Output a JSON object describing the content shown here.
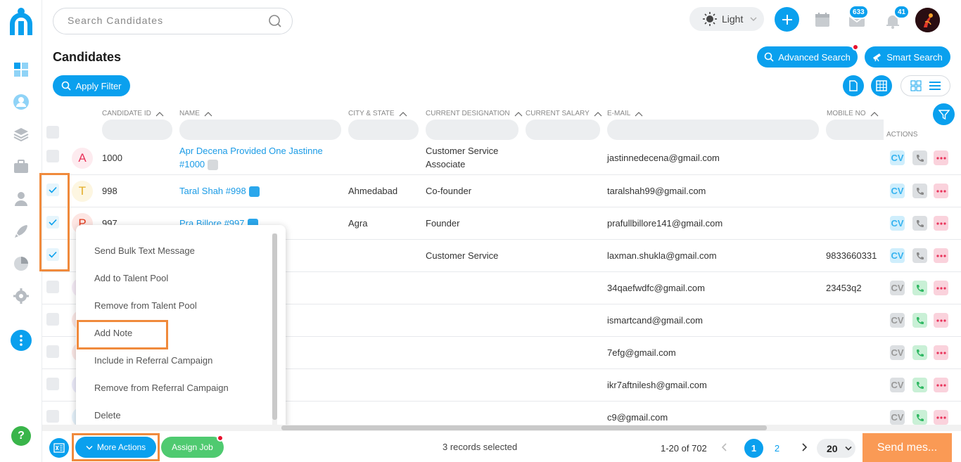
{
  "search": {
    "placeholder": "Search Candidates"
  },
  "header": {
    "theme_label": "Light",
    "mail_badge": "633",
    "notif_badge": "41"
  },
  "page": {
    "title": "Candidates",
    "advanced_search": "Advanced Search",
    "smart_search": "Smart Search",
    "apply_filter": "Apply Filter"
  },
  "table": {
    "columns": {
      "candidate_id": "CANDIDATE ID",
      "name": "NAME",
      "city_state": "CITY & STATE",
      "designation": "CURRENT DESIGNATION",
      "salary": "CURRENT SALARY",
      "email": "E-MAIL",
      "mobile": "MOBILE NO",
      "actions": "ACTIONS"
    },
    "rows": [
      {
        "initial": "A",
        "id": "1000",
        "name": "Apr Decena Provided One Jastinne",
        "name2": "#1000",
        "city": "",
        "designation": "Customer Service",
        "designation2": "Associate",
        "email": "jastinnedecena@gmail.com",
        "mobile": ""
      },
      {
        "initial": "T",
        "id": "998",
        "name": "Taral Shah #998",
        "name2": "",
        "city": "Ahmedabad",
        "designation": "Co-founder",
        "designation2": "",
        "email": "taralshah99@gmail.com",
        "mobile": ""
      },
      {
        "initial": "P",
        "id": "997",
        "name": "Pra Billore #997",
        "name2": "",
        "city": "Agra",
        "designation": "Founder",
        "designation2": "",
        "email": "prafullbillore141@gmail.com",
        "mobile": ""
      },
      {
        "initial": "",
        "id": "",
        "name": "",
        "name2": "",
        "city": "",
        "designation": "Customer Service",
        "designation2": "",
        "email": "laxman.shukla@gmail.com",
        "mobile": "9833660331"
      },
      {
        "initial": "",
        "id": "",
        "name": "",
        "name2": "",
        "city": "",
        "designation": "",
        "designation2": "",
        "email": "34qaefwdfc@gmail.com",
        "mobile": "23453q2"
      },
      {
        "initial": "",
        "id": "",
        "name": "",
        "name2": "",
        "city": "",
        "designation": "",
        "designation2": "",
        "email": "ismartcand@gmail.com",
        "mobile": ""
      },
      {
        "initial": "",
        "id": "",
        "name": "",
        "name2": "",
        "city": "",
        "designation": "",
        "designation2": "",
        "email": "7efg@gmail.com",
        "mobile": ""
      },
      {
        "initial": "",
        "id": "",
        "name": "",
        "name2": "",
        "city": "",
        "designation": "",
        "designation2": "",
        "email": "ikr7aftnilesh@gmail.com",
        "mobile": ""
      },
      {
        "initial": "",
        "id": "",
        "name": "",
        "name2": "",
        "city": "",
        "designation": "",
        "designation2": "",
        "email": "c9@gmail.com",
        "mobile": ""
      }
    ],
    "cv_label": "CV"
  },
  "menu": {
    "items": [
      "Send Bulk Text Message",
      "Add to Talent Pool",
      "Remove from Talent Pool",
      "Add Note",
      "Include in Referral Campaign",
      "Remove from Referral Campaign",
      "Delete"
    ]
  },
  "footer": {
    "more_actions": "More Actions",
    "assign_job": "Assign Job",
    "records_selected": "3 records selected",
    "page_range": "1-20 of 702",
    "page_current": "1",
    "page_next": "2",
    "per_page": "20",
    "send_message": "Send mes..."
  },
  "colors": {
    "accent": "#0aa0ee",
    "highlight": "#f08a3c",
    "send": "#fa9a55",
    "success": "#4fca70"
  }
}
